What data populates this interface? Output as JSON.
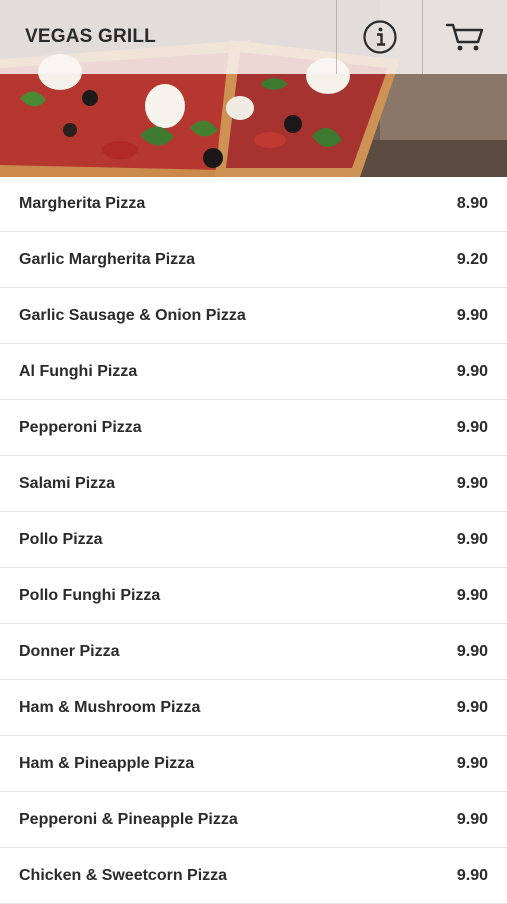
{
  "header": {
    "title": "VEGAS GRILL",
    "info_icon": "info-icon",
    "cart_icon": "cart-icon"
  },
  "menu": {
    "items": [
      {
        "name": "Margherita Pizza",
        "price": "8.90"
      },
      {
        "name": "Garlic Margherita Pizza",
        "price": "9.20"
      },
      {
        "name": "Garlic Sausage & Onion Pizza",
        "price": "9.90"
      },
      {
        "name": "Al Funghi Pizza",
        "price": "9.90"
      },
      {
        "name": "Pepperoni Pizza",
        "price": "9.90"
      },
      {
        "name": "Salami Pizza",
        "price": "9.90"
      },
      {
        "name": "Pollo Pizza",
        "price": "9.90"
      },
      {
        "name": "Pollo Funghi Pizza",
        "price": "9.90"
      },
      {
        "name": "Donner Pizza",
        "price": "9.90"
      },
      {
        "name": "Ham & Mushroom Pizza",
        "price": "9.90"
      },
      {
        "name": "Ham & Pineapple Pizza",
        "price": "9.90"
      },
      {
        "name": "Pepperoni & Pineapple Pizza",
        "price": "9.90"
      },
      {
        "name": "Chicken & Sweetcorn Pizza",
        "price": "9.90"
      }
    ]
  }
}
